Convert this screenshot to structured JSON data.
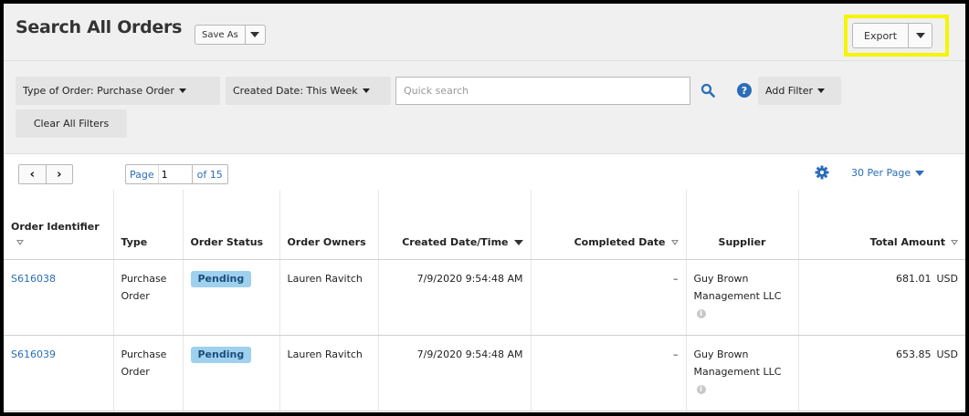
{
  "header": {
    "title": "Search All Orders",
    "save_as_label": "Save As",
    "export_label": "Export"
  },
  "filters": {
    "type_of_order": "Type of Order: Purchase Order",
    "created_date": "Created Date: This Week",
    "quick_search_placeholder": "Quick search",
    "add_filter": "Add Filter",
    "clear_all": "Clear All Filters"
  },
  "pagination": {
    "page_label": "Page",
    "page_value": "1",
    "of_label": "of 15",
    "per_page": "30 Per Page"
  },
  "table": {
    "columns": {
      "order_identifier": "Order Identifier",
      "type": "Type",
      "order_status": "Order Status",
      "order_owners": "Order Owners",
      "created": "Created Date/Time",
      "completed": "Completed Date",
      "supplier": "Supplier",
      "total": "Total Amount"
    },
    "rows": [
      {
        "id": "S616038",
        "type": "Purchase Order",
        "status": "Pending",
        "owner": "Lauren Ravitch",
        "created": "7/9/2020 9:54:48 AM",
        "completed": "–",
        "supplier": "Guy Brown Management LLC",
        "amount": "681.01",
        "currency": "USD"
      },
      {
        "id": "S616039",
        "type": "Purchase Order",
        "status": "Pending",
        "owner": "Lauren Ravitch",
        "created": "7/9/2020 9:54:48 AM",
        "completed": "–",
        "supplier": "Guy Brown Management LLC",
        "amount": "653.85",
        "currency": "USD"
      }
    ]
  },
  "colors": {
    "link": "#2a6db8",
    "badge_bg": "#9fd0ee",
    "highlight": "#f5f500"
  }
}
